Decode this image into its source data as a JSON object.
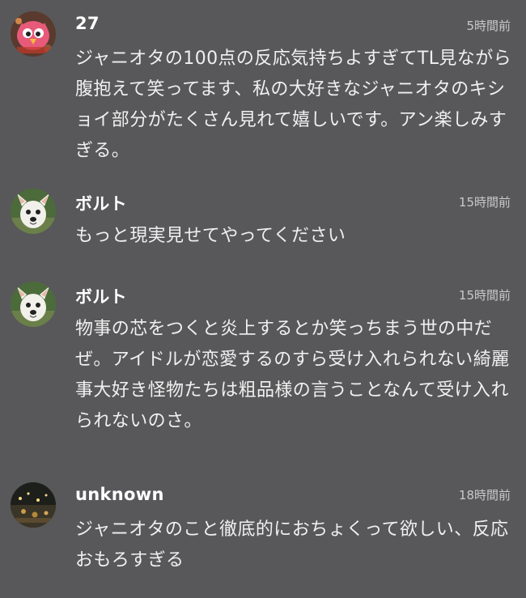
{
  "comments": [
    {
      "username": "27",
      "timestamp": "5時間前",
      "avatar_icon": "pink-cartoon-bird-avatar-icon",
      "text": "ジャニオタの100点の反応気持ちよすぎてTL見ながら腹抱えて笑ってます、私の大好きなジャニオタのキショイ部分がたくさん見れて嬉しいです。アン楽しみすぎる。"
    },
    {
      "username": "ボルト",
      "timestamp": "15時間前",
      "avatar_icon": "white-dog-avatar-icon",
      "text": "もっと現実見せてやってください"
    },
    {
      "username": "ボルト",
      "timestamp": "15時間前",
      "avatar_icon": "white-dog-avatar-icon",
      "text": "物事の芯をつくと炎上するとか笑っちまう世の中だぜ。アイドルが恋愛するのすら受け入れられない綺麗事大好き怪物たちは粗品様の言うことなんて受け入れられないのさ。"
    },
    {
      "username": "unknown",
      "timestamp": "18時間前",
      "avatar_icon": "night-lights-photo-avatar-icon",
      "text": "ジャニオタのこと徹底的におちょくって欲しい、反応おもろすぎる"
    }
  ],
  "colors": {
    "background": "#58585a",
    "username": "#ffffff",
    "timestamp": "#c9c9c9",
    "body_text": "#f0f0f0"
  }
}
